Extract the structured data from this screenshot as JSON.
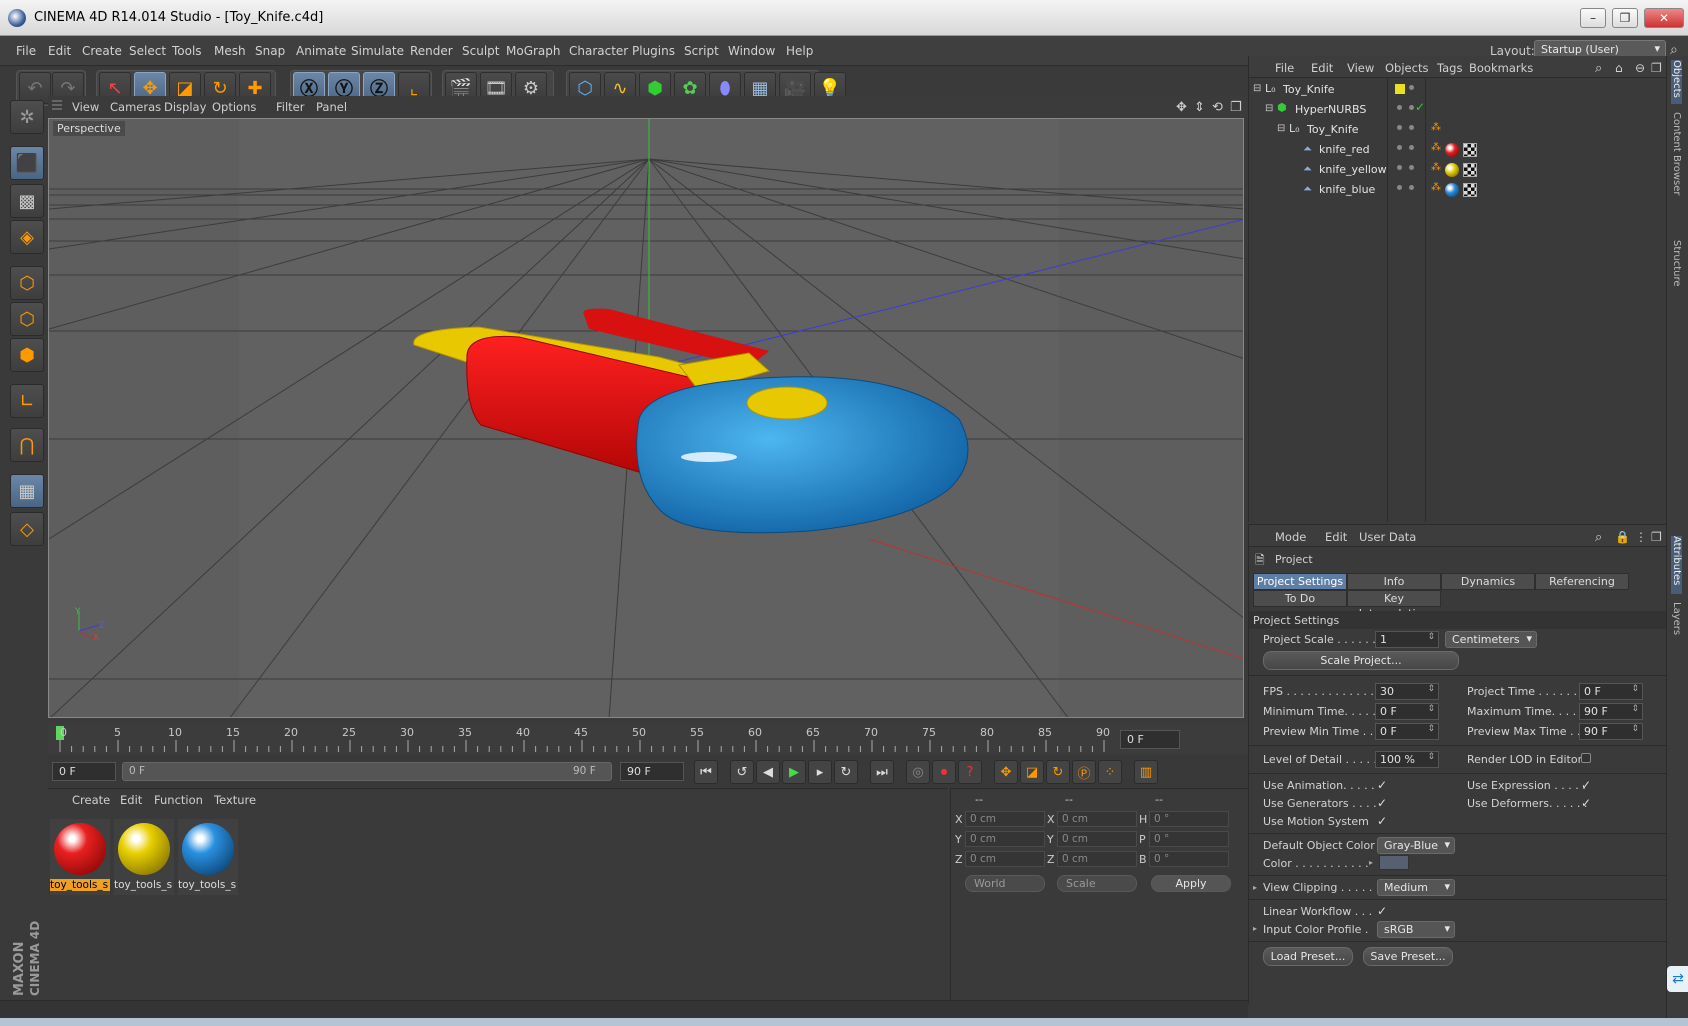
{
  "window": {
    "title": "CINEMA 4D R14.014 Studio - [Toy_Knife.c4d]"
  },
  "menubar": [
    "File",
    "Edit",
    "Create",
    "Select",
    "Tools",
    "Mesh",
    "Snap",
    "Animate",
    "Simulate",
    "Render",
    "Sculpt",
    "MoGraph",
    "Character",
    "Plugins",
    "Script",
    "Window",
    "Help"
  ],
  "layout": {
    "label": "Layout:",
    "value": "Startup (User)"
  },
  "viewport": {
    "menu": [
      "View",
      "Cameras",
      "Display",
      "Options",
      "Filter",
      "Panel"
    ],
    "label": "Perspective",
    "axes": {
      "y": "Y",
      "x": "X",
      "z": "Z"
    }
  },
  "timeline": {
    "ticks": [
      "0",
      "5",
      "10",
      "15",
      "20",
      "25",
      "30",
      "35",
      "40",
      "45",
      "50",
      "55",
      "60",
      "65",
      "70",
      "75",
      "80",
      "85",
      "90"
    ],
    "current_frame": "0 F",
    "start": "0 F",
    "slider_start": "0 F",
    "slider_end": "90 F",
    "end": "90 F"
  },
  "material_panel": {
    "menu": [
      "Create",
      "Edit",
      "Function",
      "Texture"
    ],
    "materials": [
      {
        "name": "toy_tools_s",
        "color": "#d41010"
      },
      {
        "name": "toy_tools_s",
        "color": "#d8c000"
      },
      {
        "name": "toy_tools_s",
        "color": "#1d80c8"
      }
    ]
  },
  "coord_panel": {
    "headers": [
      "--",
      "--",
      "--"
    ],
    "rows": [
      {
        "l1": "X",
        "v1": "0 cm",
        "l2": "X",
        "v2": "0 cm",
        "l3": "H",
        "v3": "0 °"
      },
      {
        "l1": "Y",
        "v1": "0 cm",
        "l2": "Y",
        "v2": "0 cm",
        "l3": "P",
        "v3": "0 °"
      },
      {
        "l1": "Z",
        "v1": "0 cm",
        "l2": "Z",
        "v2": "0 cm",
        "l3": "B",
        "v3": "0 °"
      }
    ],
    "world": "World",
    "scale": "Scale",
    "apply": "Apply"
  },
  "objects_panel": {
    "menu": [
      "File",
      "Edit",
      "View",
      "Objects",
      "Tags",
      "Bookmarks"
    ],
    "tree": [
      {
        "name": "Toy_Knife"
      },
      {
        "name": "HyperNURBS"
      },
      {
        "name": "Toy_Knife"
      },
      {
        "name": "knife_red"
      },
      {
        "name": "knife_yellow"
      },
      {
        "name": "knife_blue"
      }
    ]
  },
  "attributes_panel": {
    "menu": [
      "Mode",
      "Edit",
      "User Data"
    ],
    "object": "Project",
    "tabs_row1": [
      "Project Settings",
      "Info",
      "Dynamics",
      "Referencing"
    ],
    "tabs_row2": [
      "To Do",
      "Key Interpolation"
    ],
    "section": "Project Settings",
    "project_scale": {
      "label": "Project Scale . . . . . .",
      "value": "1",
      "unit": "Centimeters"
    },
    "scale_project": "Scale Project...",
    "fps": {
      "label": "FPS . . . . . . . . . . . . . .",
      "value": "30"
    },
    "project_time": {
      "label": "Project Time . . . . . . . .",
      "value": "0 F"
    },
    "minimum_time": {
      "label": "Minimum Time. . . . .",
      "value": "0 F"
    },
    "maximum_time": {
      "label": "Maximum Time. . . . . .",
      "value": "90 F"
    },
    "preview_min": {
      "label": "Preview Min Time . .",
      "value": "0 F"
    },
    "preview_max": {
      "label": "Preview Max Time . . .",
      "value": "90 F"
    },
    "level_of_detail": {
      "label": "Level of Detail . . . . .",
      "value": "100 %"
    },
    "render_lod": {
      "label": "Render LOD in Editor"
    },
    "use_animation": "Use Animation. . . . .",
    "use_expression": "Use Expression . . . . .",
    "use_generators": "Use Generators . . . .",
    "use_deformers": "Use Deformers. . . . . .",
    "use_motion": "Use Motion System",
    "default_object_color": {
      "label": "Default Object Color",
      "value": "Gray-Blue"
    },
    "color": {
      "label": "Color . . . . . . . . . . ."
    },
    "view_clipping": {
      "label": "View Clipping . . . . .",
      "value": "Medium"
    },
    "linear_workflow": "Linear Workflow . . .",
    "input_color_profile": {
      "label": "Input Color Profile .",
      "value": "sRGB"
    },
    "load_preset": "Load Preset...",
    "save_preset": "Save Preset..."
  },
  "right_strip": [
    "Objects",
    "Content Browser",
    "Structure",
    "Attributes",
    "Layers"
  ],
  "branding": {
    "line1": "MAXON",
    "line2": "CINEMA 4D"
  }
}
